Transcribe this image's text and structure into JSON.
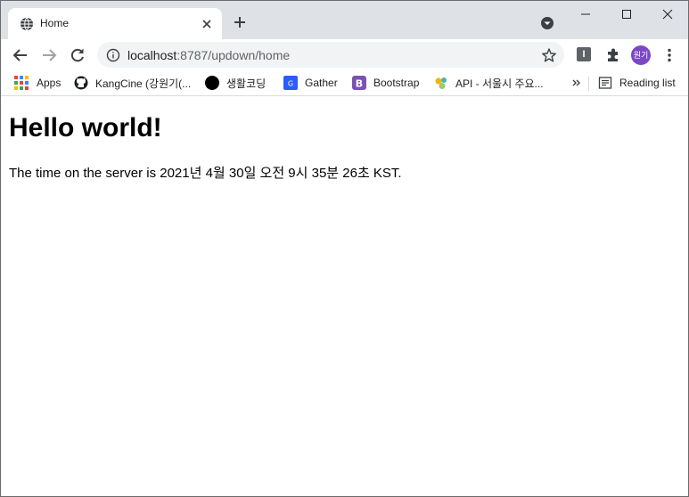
{
  "tab": {
    "title": "Home",
    "icon": "globe-icon"
  },
  "window_controls": [
    "minimize-icon",
    "maximize-icon",
    "close-icon"
  ],
  "address": {
    "host": "localhost",
    "path": ":8787/updown/home"
  },
  "profile_initials": "원기",
  "extension_badge": "I",
  "bookmarks": [
    {
      "label": "Apps",
      "icon": "apps-grid-icon"
    },
    {
      "label": "KangCine (강원기(...",
      "icon": "github-icon"
    },
    {
      "label": "생활코딩",
      "icon": "black-circle-icon"
    },
    {
      "label": "Gather",
      "icon": "gather-icon"
    },
    {
      "label": "Bootstrap",
      "icon": "bootstrap-icon"
    },
    {
      "label": "API - 서울시 주요...",
      "icon": "api-icon"
    }
  ],
  "reading_list_label": "Reading list",
  "page": {
    "heading": "Hello world!",
    "server_time": "The time on the server is 2021년 4월 30일 오전 9시 35분 26초 KST."
  },
  "colors": {
    "tabstrip_bg": "#dee1e6",
    "omnibox_bg": "#f1f3f4",
    "avatar_bg": "#7b47c7",
    "gather_blue": "#2d5bff",
    "bootstrap_purple": "#7952b3"
  }
}
